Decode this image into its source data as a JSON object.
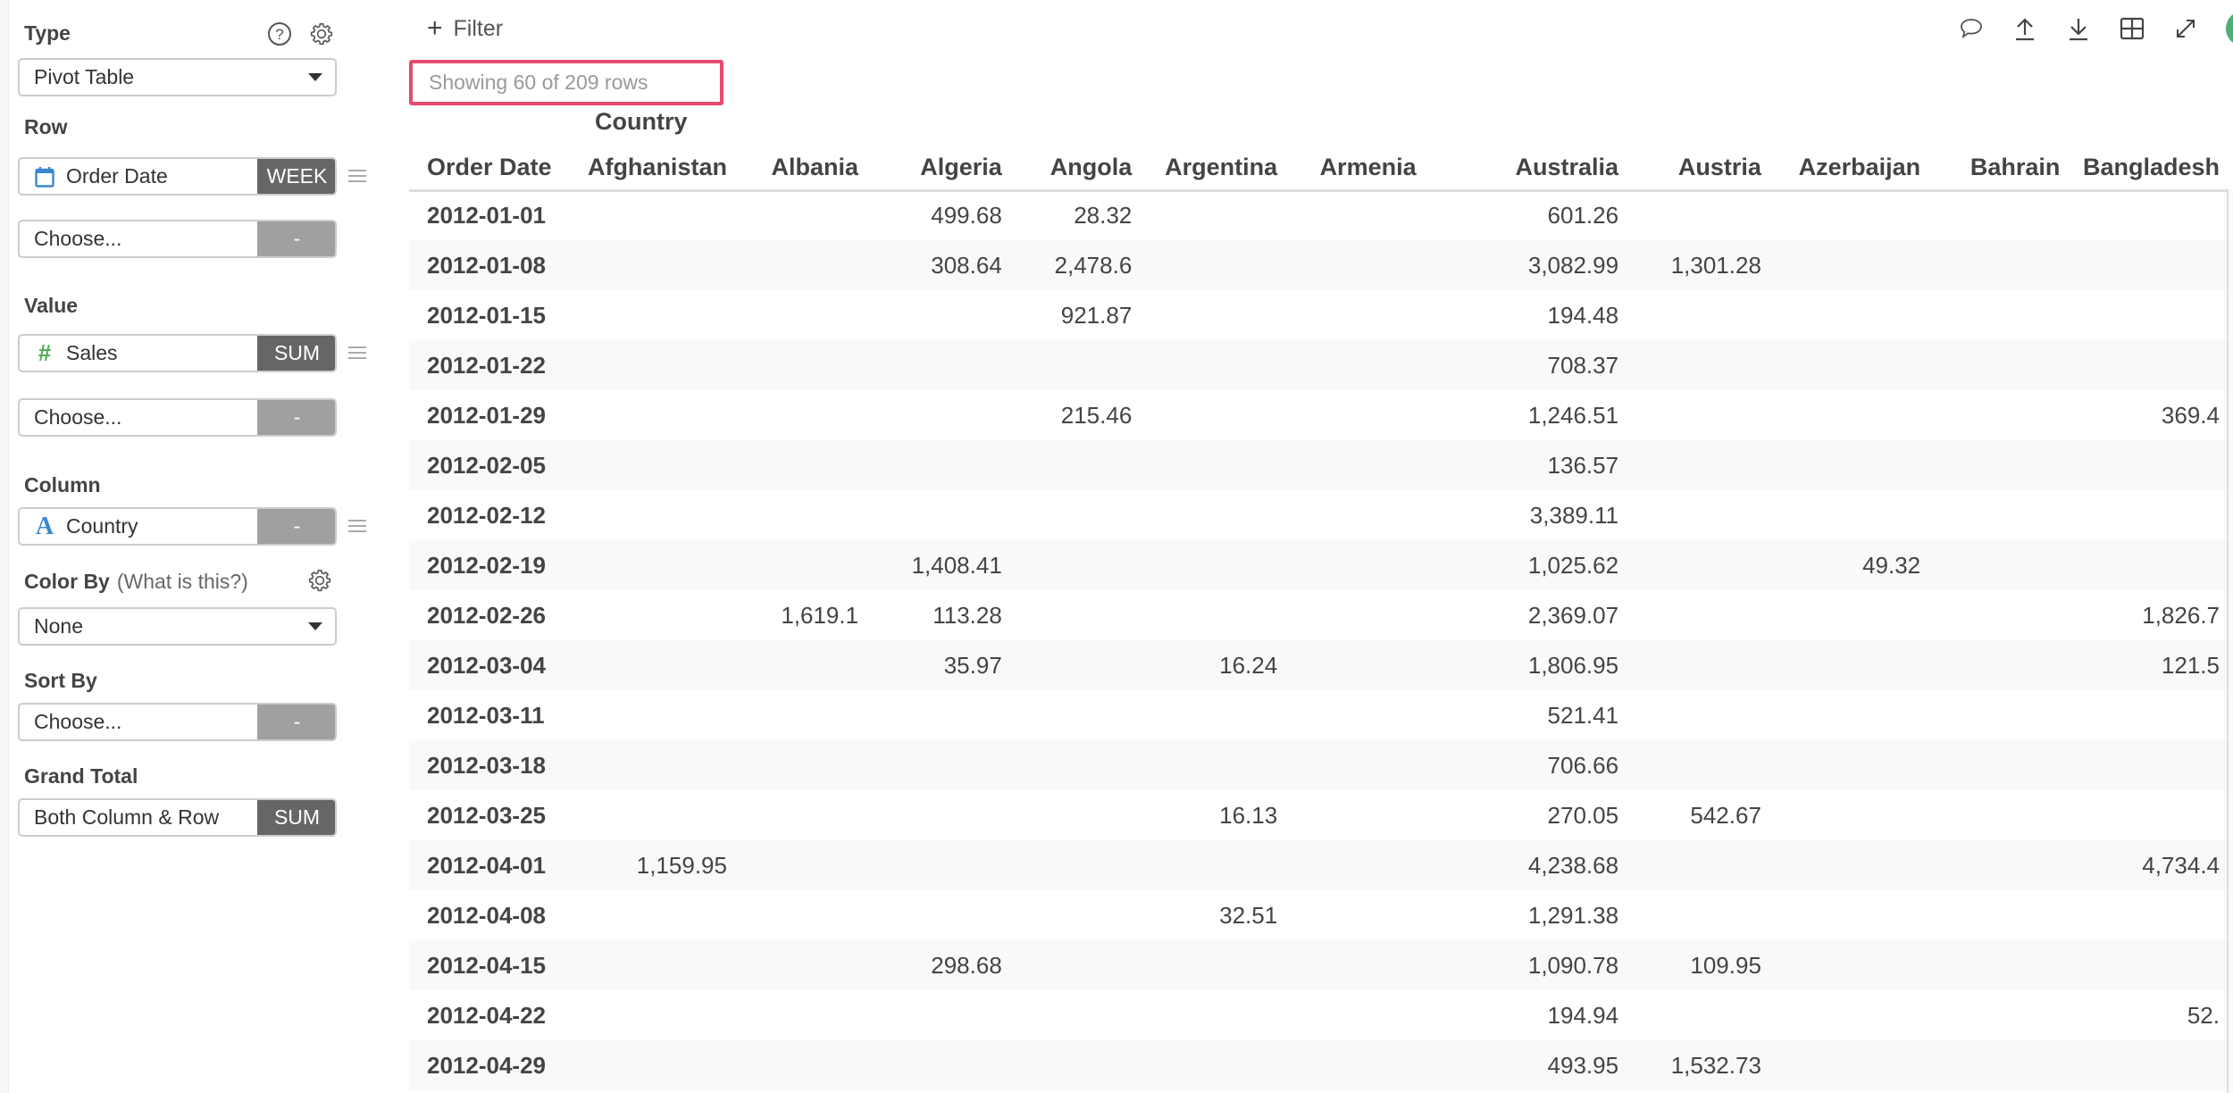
{
  "sidebar": {
    "type": {
      "label": "Type",
      "value": "Pivot Table",
      "help_icon": "question-circle-icon",
      "settings_icon": "gear-icon"
    },
    "row": {
      "label": "Row",
      "fields": [
        {
          "name": "Order Date",
          "type_icon": "calendar-icon",
          "agg": "WEEK"
        },
        {
          "name": "Choose...",
          "agg": "-"
        }
      ]
    },
    "value": {
      "label": "Value",
      "fields": [
        {
          "name": "Sales",
          "type_icon": "number-hash-icon",
          "agg": "SUM"
        },
        {
          "name": "Choose...",
          "agg": "-"
        }
      ]
    },
    "column": {
      "label": "Column",
      "fields": [
        {
          "name": "Country",
          "type_icon": "text-A-icon",
          "agg": "-"
        }
      ]
    },
    "color_by": {
      "label": "Color By",
      "help_text": "(What is this?)",
      "value": "None"
    },
    "sort_by": {
      "label": "Sort By",
      "value": "Choose...",
      "agg": "-"
    },
    "grand_total": {
      "label": "Grand Total",
      "value": "Both Column & Row",
      "agg": "SUM"
    }
  },
  "toolbar": {
    "filter_label": "Filter",
    "icons": [
      "comment-icon",
      "upload-icon",
      "download-icon",
      "table-grid-icon",
      "expand-icon"
    ]
  },
  "rows_info": "Showing 60 of 209 rows",
  "colors": {
    "highlight_border": "#e8496f",
    "dark_button": "#666666",
    "light_button": "#a0a0a0",
    "calendar_icon": "#3a87d0",
    "number_icon": "#4caf50",
    "text_icon": "#3a87d0",
    "avatar": "#4caf76"
  },
  "pivot": {
    "column_group_label": "Country",
    "row_header": "Order Date",
    "columns": [
      "Afghanistan",
      "Albania",
      "Algeria",
      "Angola",
      "Argentina",
      "Armenia",
      "Australia",
      "Austria",
      "Azerbaijan",
      "Bahrain",
      "Bangladesh"
    ],
    "rows": [
      {
        "date": "2012-01-01",
        "cells": [
          "",
          "",
          "499.68",
          "28.32",
          "",
          "",
          "601.26",
          "",
          "",
          "",
          ""
        ]
      },
      {
        "date": "2012-01-08",
        "cells": [
          "",
          "",
          "308.64",
          "2,478.6",
          "",
          "",
          "3,082.99",
          "1,301.28",
          "",
          "",
          ""
        ]
      },
      {
        "date": "2012-01-15",
        "cells": [
          "",
          "",
          "",
          "921.87",
          "",
          "",
          "194.48",
          "",
          "",
          "",
          ""
        ]
      },
      {
        "date": "2012-01-22",
        "cells": [
          "",
          "",
          "",
          "",
          "",
          "",
          "708.37",
          "",
          "",
          "",
          ""
        ]
      },
      {
        "date": "2012-01-29",
        "cells": [
          "",
          "",
          "",
          "215.46",
          "",
          "",
          "1,246.51",
          "",
          "",
          "",
          "369.4"
        ]
      },
      {
        "date": "2012-02-05",
        "cells": [
          "",
          "",
          "",
          "",
          "",
          "",
          "136.57",
          "",
          "",
          "",
          ""
        ]
      },
      {
        "date": "2012-02-12",
        "cells": [
          "",
          "",
          "",
          "",
          "",
          "",
          "3,389.11",
          "",
          "",
          "",
          ""
        ]
      },
      {
        "date": "2012-02-19",
        "cells": [
          "",
          "",
          "1,408.41",
          "",
          "",
          "",
          "1,025.62",
          "",
          "49.32",
          "",
          ""
        ]
      },
      {
        "date": "2012-02-26",
        "cells": [
          "",
          "1,619.1",
          "113.28",
          "",
          "",
          "",
          "2,369.07",
          "",
          "",
          "",
          "1,826.7"
        ]
      },
      {
        "date": "2012-03-04",
        "cells": [
          "",
          "",
          "35.97",
          "",
          "16.24",
          "",
          "1,806.95",
          "",
          "",
          "",
          "121.5"
        ]
      },
      {
        "date": "2012-03-11",
        "cells": [
          "",
          "",
          "",
          "",
          "",
          "",
          "521.41",
          "",
          "",
          "",
          ""
        ]
      },
      {
        "date": "2012-03-18",
        "cells": [
          "",
          "",
          "",
          "",
          "",
          "",
          "706.66",
          "",
          "",
          "",
          ""
        ]
      },
      {
        "date": "2012-03-25",
        "cells": [
          "",
          "",
          "",
          "",
          "16.13",
          "",
          "270.05",
          "542.67",
          "",
          "",
          ""
        ]
      },
      {
        "date": "2012-04-01",
        "cells": [
          "1,159.95",
          "",
          "",
          "",
          "",
          "",
          "4,238.68",
          "",
          "",
          "",
          "4,734.4"
        ]
      },
      {
        "date": "2012-04-08",
        "cells": [
          "",
          "",
          "",
          "",
          "32.51",
          "",
          "1,291.38",
          "",
          "",
          "",
          ""
        ]
      },
      {
        "date": "2012-04-15",
        "cells": [
          "",
          "",
          "298.68",
          "",
          "",
          "",
          "1,090.78",
          "109.95",
          "",
          "",
          ""
        ]
      },
      {
        "date": "2012-04-22",
        "cells": [
          "",
          "",
          "",
          "",
          "",
          "",
          "194.94",
          "",
          "",
          "",
          "52."
        ]
      },
      {
        "date": "2012-04-29",
        "cells": [
          "",
          "",
          "",
          "",
          "",
          "",
          "493.95",
          "1,532.73",
          "",
          "",
          ""
        ]
      }
    ]
  }
}
